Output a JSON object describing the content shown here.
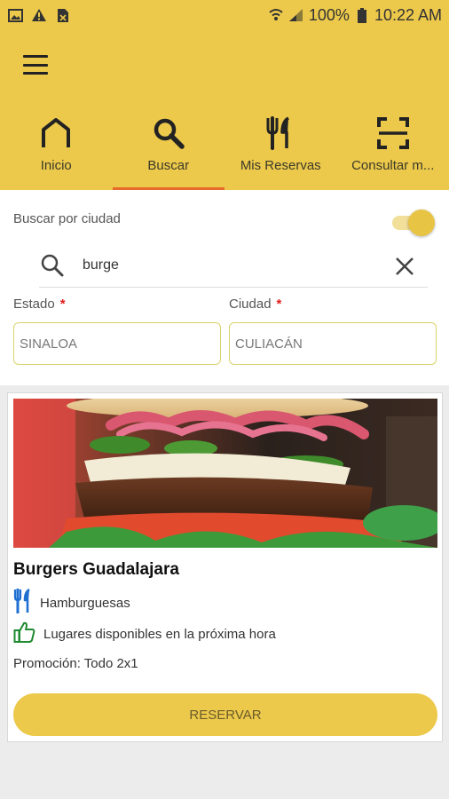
{
  "status_bar": {
    "battery": "100%",
    "time": "10:22 AM"
  },
  "tabs": [
    {
      "label": "Inicio",
      "icon": "home-icon"
    },
    {
      "label": "Buscar",
      "icon": "search-icon"
    },
    {
      "label": "Mis Reservas",
      "icon": "utensils-icon"
    },
    {
      "label": "Consultar m...",
      "icon": "scan-icon"
    }
  ],
  "active_tab": "Buscar",
  "filters": {
    "toggle_label": "Buscar por ciudad",
    "toggle_on": true,
    "search_value": "burge",
    "estado_label": "Estado",
    "estado_value": "SINALOA",
    "ciudad_label": "Ciudad",
    "ciudad_value": "CULIACÁN",
    "required_mark": "*"
  },
  "result": {
    "title": "Burgers Guadalajara",
    "category": "Hamburguesas",
    "availability": "Lugares disponibles en la próxima hora",
    "promo": "Promoción: Todo 2x1",
    "reserve_label": "RESERVAR"
  },
  "colors": {
    "brand": "#ecc94b",
    "tab_indicator": "#e86a2a",
    "required": "#e21b1b",
    "category_icon": "#1f6fd1",
    "availability_icon": "#1f8a2e"
  }
}
